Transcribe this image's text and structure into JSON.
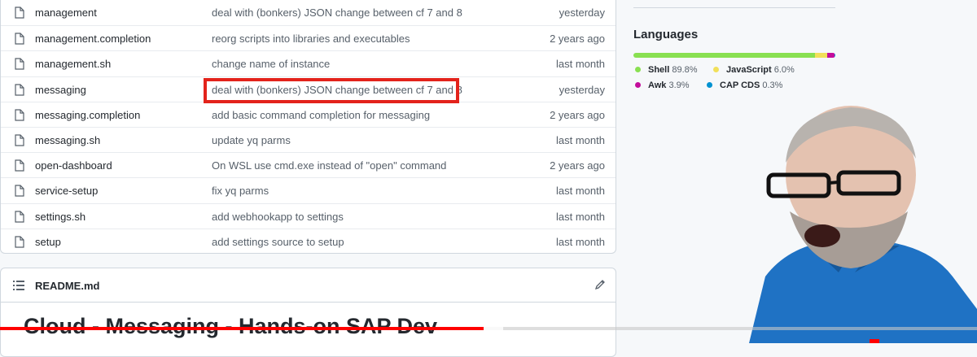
{
  "files": [
    {
      "name": "management",
      "message": "deal with (bonkers) JSON change between cf 7 and 8",
      "date": "yesterday",
      "icon": "file-icon"
    },
    {
      "name": "management.completion",
      "message": "reorg scripts into libraries and executables",
      "date": "2 years ago",
      "icon": "file-icon"
    },
    {
      "name": "management.sh",
      "message": "change name of instance",
      "date": "last month",
      "icon": "file-icon"
    },
    {
      "name": "messaging",
      "message": "deal with (bonkers) JSON change between cf 7 and 8",
      "date": "yesterday",
      "icon": "file-icon",
      "highlighted": true
    },
    {
      "name": "messaging.completion",
      "message": "add basic command completion for messaging",
      "date": "2 years ago",
      "icon": "file-icon"
    },
    {
      "name": "messaging.sh",
      "message": "update yq parms",
      "date": "last month",
      "icon": "file-icon"
    },
    {
      "name": "open-dashboard",
      "message": "On WSL use cmd.exe instead of \"open\" command",
      "date": "2 years ago",
      "icon": "file-icon"
    },
    {
      "name": "service-setup",
      "message": "fix yq parms",
      "date": "last month",
      "icon": "file-icon"
    },
    {
      "name": "settings.sh",
      "message": "add webhookapp to settings",
      "date": "last month",
      "icon": "file-icon"
    },
    {
      "name": "setup",
      "message": "add settings source to setup",
      "date": "last month",
      "icon": "file-icon"
    }
  ],
  "readme": {
    "file_name": "README.md",
    "heading": "Cloud - Messaging - Hands-on SAP Dev",
    "list_icon": "list-icon",
    "edit_icon": "pencil-icon"
  },
  "languages": {
    "title": "Languages",
    "items": [
      {
        "name": "Shell",
        "percent": "89.8%",
        "value": 89.8,
        "color": "#89e051"
      },
      {
        "name": "JavaScript",
        "percent": "6.0%",
        "value": 6.0,
        "color": "#f1e05a"
      },
      {
        "name": "Awk",
        "percent": "3.9%",
        "value": 3.9,
        "color": "#c30e9b"
      },
      {
        "name": "CAP CDS",
        "percent": "0.3%",
        "value": 0.3,
        "color": "#0092d1"
      }
    ]
  },
  "video": {
    "progress": 0.495,
    "buffered": 0.515,
    "accent": "#ff0000"
  },
  "colors": {
    "highlight_box": "#e3231b",
    "presenter_shirt": "#1f72c4"
  }
}
